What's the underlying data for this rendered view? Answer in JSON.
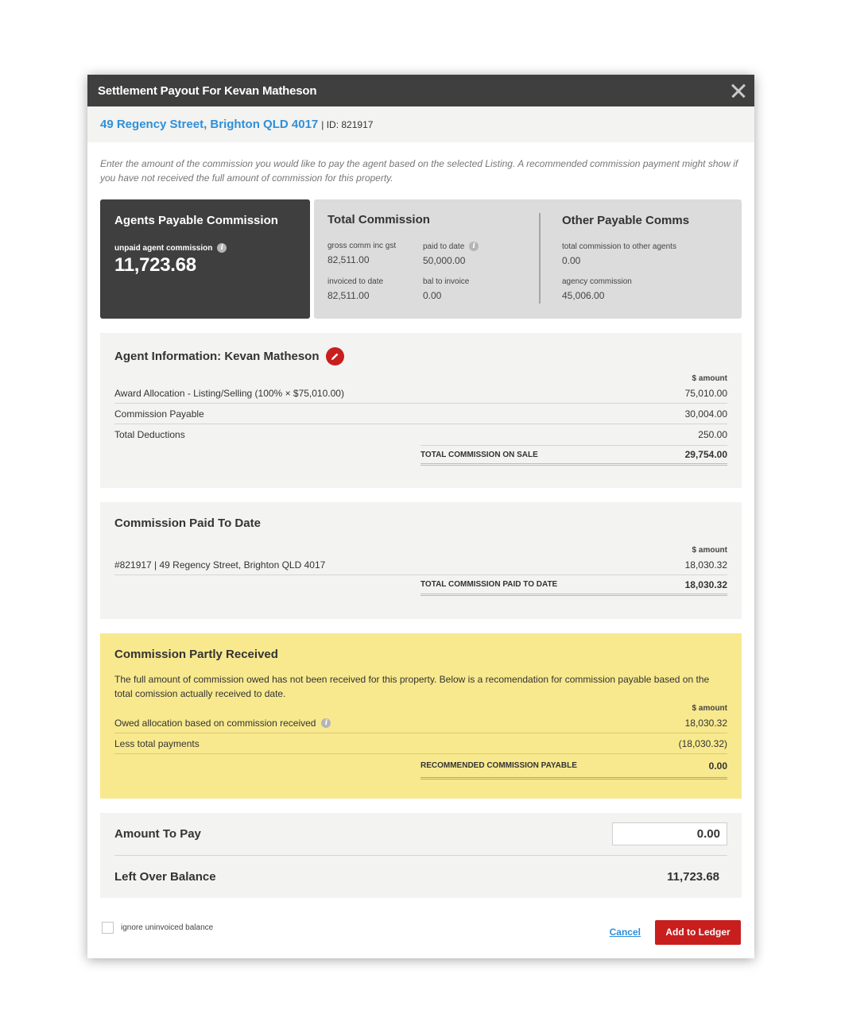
{
  "modal": {
    "title": "Settlement Payout For Kevan Matheson"
  },
  "listing": {
    "address": "49 Regency Street, Brighton QLD 4017",
    "id_text": "| ID: 821917"
  },
  "intro": "Enter the amount of the commission you would like to pay the agent based on the selected Listing. A recommended commission payment might show if you have not received the full amount of commission for this property.",
  "summary": {
    "agents_card": {
      "title": "Agents Payable Commission",
      "label": "unpaid agent commission",
      "value": "11,723.68"
    },
    "total_commission": {
      "title": "Total Commission",
      "items": [
        {
          "label": "gross comm inc gst",
          "value": "82,511.00"
        },
        {
          "label": "paid to date",
          "value": "50,000.00"
        },
        {
          "label": "invoiced to date",
          "value": "82,511.00"
        },
        {
          "label": "bal to invoice",
          "value": "0.00"
        }
      ]
    },
    "other_payable": {
      "title": "Other Payable Comms",
      "items": [
        {
          "label": "total commission to other agents",
          "value": "0.00"
        },
        {
          "label": "agency commission",
          "value": "45,006.00"
        }
      ]
    }
  },
  "agent_info": {
    "title": "Agent Information: Kevan Matheson",
    "amount_header": "$ amount",
    "rows": [
      {
        "label": "Award Allocation - Listing/Selling (100% × $75,010.00)",
        "value": "75,010.00"
      },
      {
        "label": "Commission Payable",
        "value": "30,004.00"
      },
      {
        "label": "Total Deductions",
        "value": "250.00"
      }
    ],
    "total_label": "TOTAL COMMISSION ON SALE",
    "total_value": "29,754.00"
  },
  "paid_to_date": {
    "title": "Commission Paid To Date",
    "amount_header": "$ amount",
    "rows": [
      {
        "label": "#821917 | 49 Regency Street, Brighton QLD 4017",
        "value": "18,030.32"
      }
    ],
    "total_label": "TOTAL COMMISSION PAID TO DATE",
    "total_value": "18,030.32"
  },
  "partly_received": {
    "title": "Commission Partly Received",
    "description": "The full amount of commission owed has not been received for this property. Below is a recomendation for commission payable based on the total comission actually received to date.",
    "amount_header": "$ amount",
    "rows": [
      {
        "label": "Owed allocation based on commission received",
        "value": "18,030.32"
      },
      {
        "label": "Less total payments",
        "value": "(18,030.32)"
      }
    ],
    "total_label": "RECOMMENDED COMMISSION PAYABLE",
    "total_value": "0.00"
  },
  "payment": {
    "amount_label": "Amount To Pay",
    "amount_value": "0.00",
    "balance_label": "Left Over Balance",
    "balance_value": "11,723.68"
  },
  "footer": {
    "checkbox_label": "ignore uninvoiced balance",
    "cancel_label": "Cancel",
    "add_label": "Add to Ledger"
  },
  "colors": {
    "header": "#3f3f3f",
    "link": "#2f8fd8",
    "accent": "#c81e1e",
    "warning_bg": "#f8e98e"
  }
}
